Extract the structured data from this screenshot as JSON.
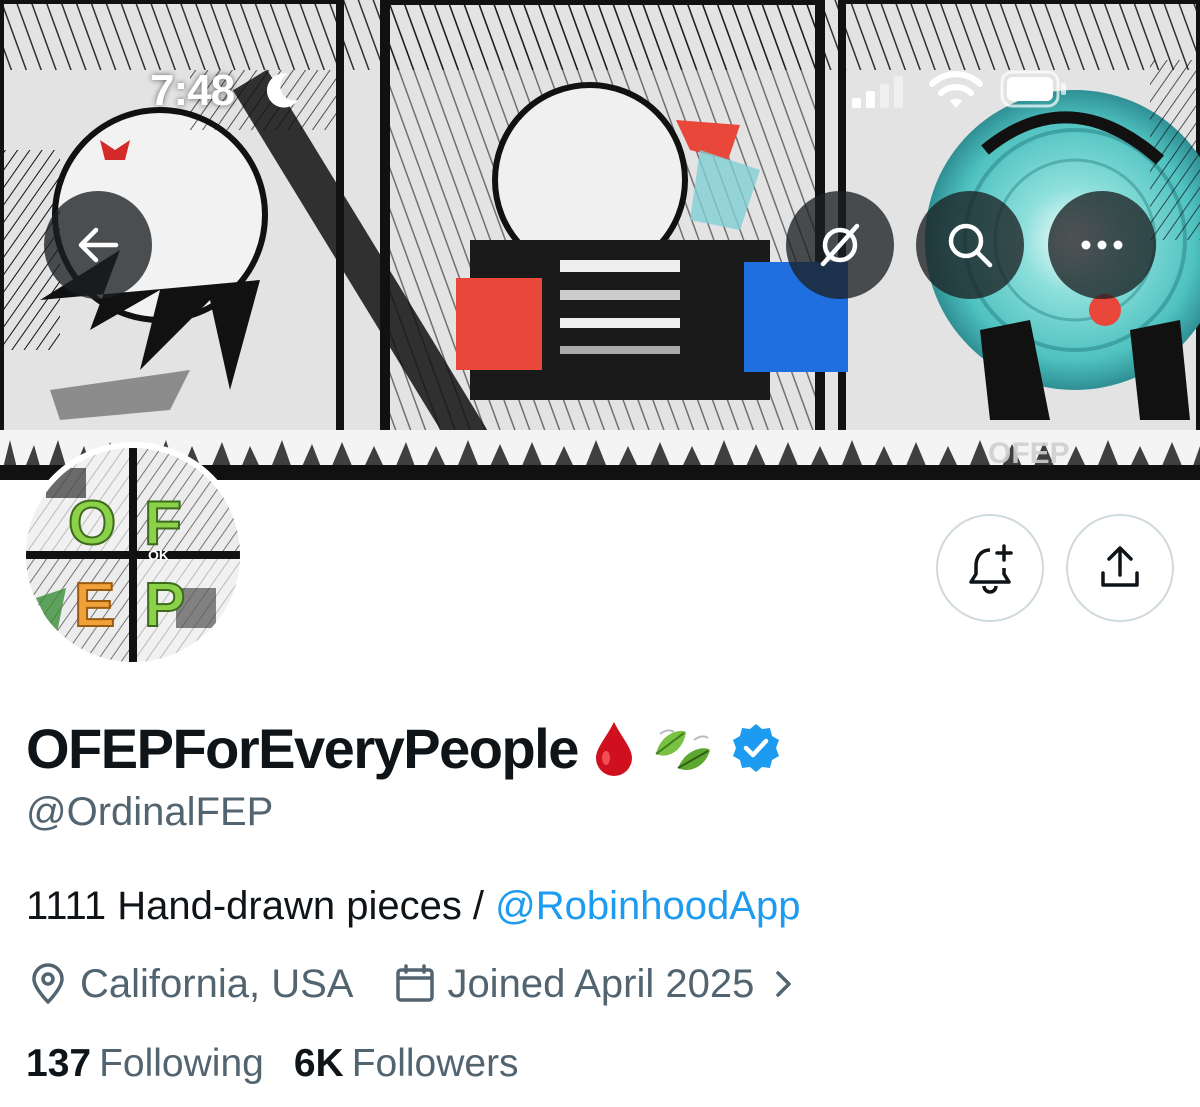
{
  "status_bar": {
    "time": "7:48"
  },
  "banner": {
    "watermark": "OFEP"
  },
  "avatar": {
    "letters": [
      "O",
      "F",
      "E",
      "P"
    ],
    "small_text": "OK"
  },
  "profile": {
    "display_name": "OFEPForEveryPeople",
    "name_emojis": [
      "drop-of-blood",
      "leaf-fluttering-in-wind",
      "verified-badge"
    ],
    "handle": "@OrdinalFEP",
    "bio_text": "1111 Hand-drawn pieces / ",
    "bio_link": "@RobinhoodApp",
    "location": "California, USA",
    "joined": "Joined April 2025"
  },
  "stats": {
    "following_count": "137",
    "following_label": "Following",
    "followers_count": "6K",
    "followers_label": "Followers"
  },
  "colors": {
    "accent": "#1d9bf0",
    "secondary_text": "#536471",
    "primary_text": "#0f1419",
    "border": "#cfd9de",
    "verified": "#1d9bf0",
    "banner_red": "#e8473a",
    "banner_blue": "#1f6fe0",
    "banner_teal": "#6fd3cf"
  },
  "icons": [
    "back-arrow-icon",
    "grok-icon",
    "search-icon",
    "more-icon",
    "bell-plus-icon",
    "share-icon",
    "location-pin-icon",
    "calendar-icon",
    "chevron-right-icon",
    "signal-icon",
    "wifi-icon",
    "battery-icon",
    "moon-icon"
  ]
}
